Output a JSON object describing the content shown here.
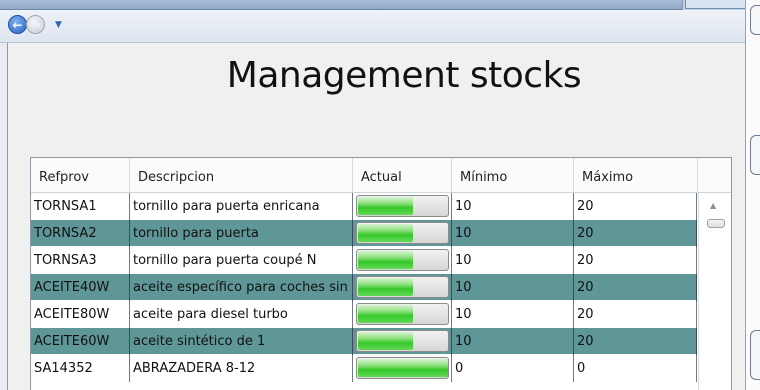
{
  "page_title": "Management stocks",
  "nav": {
    "back_glyph": "←",
    "forward_glyph": "→",
    "menu_glyph": "▼"
  },
  "grid": {
    "headers": [
      "Refprov",
      "Descripcion",
      "Actual",
      "Mínimo",
      "Máximo"
    ],
    "rows": [
      {
        "refprov": "TORNSA1",
        "descripcion": "tornillo para puerta enricana",
        "actual_fill": 0.6,
        "minimo": "10",
        "maximo": "20",
        "style": "norm"
      },
      {
        "refprov": "TORNSA2",
        "descripcion": "tornillo para puerta",
        "actual_fill": 0.6,
        "minimo": "10",
        "maximo": "20",
        "style": "alt"
      },
      {
        "refprov": "TORNSA3",
        "descripcion": "tornillo para puerta coupé N",
        "actual_fill": 0.6,
        "minimo": "10",
        "maximo": "20",
        "style": "norm"
      },
      {
        "refprov": "ACEITE40W",
        "descripcion": "aceite específico para coches sin",
        "actual_fill": 0.6,
        "minimo": "10",
        "maximo": "20",
        "style": "alt"
      },
      {
        "refprov": "ACEITE80W",
        "descripcion": "aceite para diesel turbo",
        "actual_fill": 0.6,
        "minimo": "10",
        "maximo": "20",
        "style": "norm"
      },
      {
        "refprov": "ACEITE60W",
        "descripcion": "aceite sintético de 1",
        "actual_fill": 0.6,
        "minimo": "10",
        "maximo": "20",
        "style": "alt"
      },
      {
        "refprov": "SA14352",
        "descripcion": "ABRAZADERA 8-12",
        "actual_fill": 1.0,
        "minimo": "0",
        "maximo": "0",
        "style": "norm"
      }
    ]
  },
  "scroll": {
    "up_glyph": "▲"
  }
}
